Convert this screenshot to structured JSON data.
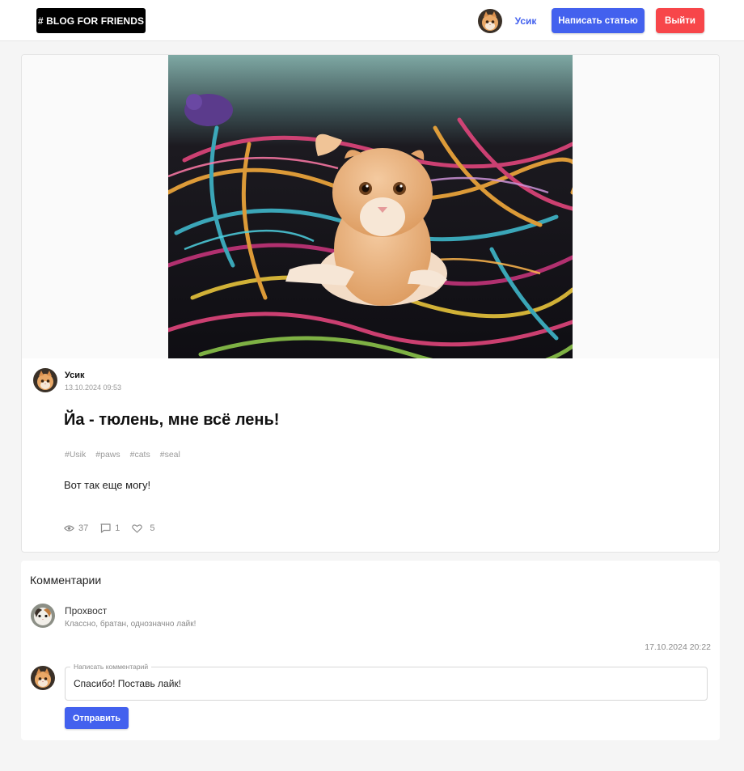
{
  "header": {
    "logo": "# BLOG FOR FRIENDS",
    "user_name": "Усик",
    "write_button": "Написать статью",
    "logout_button": "Выйти"
  },
  "post": {
    "author": "Усик",
    "date": "13.10.2024 09:53",
    "title": "Йа - тюлень, мне всё лень!",
    "tags": [
      "#Usik",
      "#paws",
      "#cats",
      "#seal"
    ],
    "text": "Вот так еще могу!",
    "views": "37",
    "comments": "1",
    "likes": "5"
  },
  "comments": {
    "title": "Комментарии",
    "items": [
      {
        "author": "Прохвост",
        "text": "Классно, братан, однозначно лайк!",
        "date": "17.10.2024 20:22"
      }
    ],
    "form": {
      "label": "Написать комментарий",
      "value": "Спасибо! Поставь лайк!",
      "submit": "Отправить"
    }
  },
  "colors": {
    "accent": "#4361ee",
    "danger": "#f7464a"
  }
}
